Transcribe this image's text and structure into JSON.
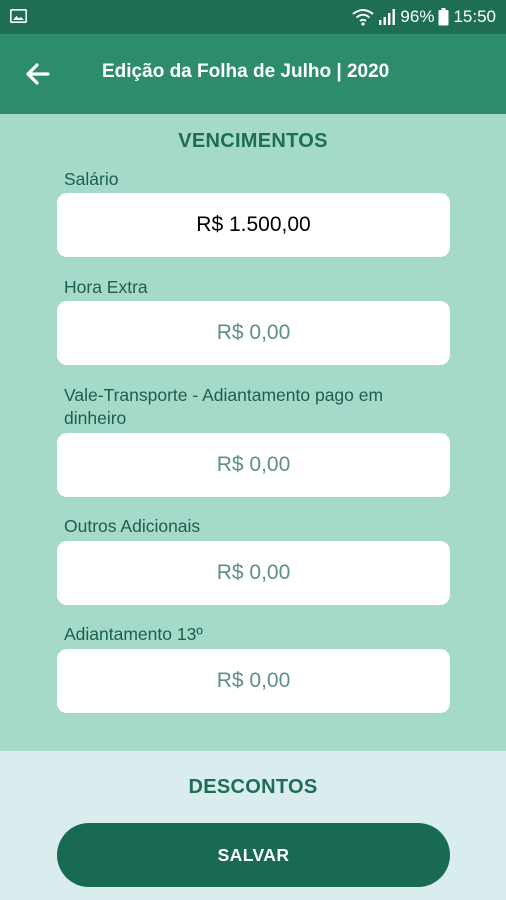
{
  "status_bar": {
    "battery": "96%",
    "time": "15:50",
    "icons": [
      "image-icon",
      "wifi-icon",
      "signal-icon",
      "battery-icon"
    ]
  },
  "app_bar": {
    "title": "Edição da Folha de Julho | 2020",
    "back_icon": "arrow-left-icon"
  },
  "vencimentos": {
    "title": "VENCIMENTOS",
    "fields": [
      {
        "label": "Salário",
        "value": "R$ 1.500,00"
      },
      {
        "label": "Hora Extra",
        "placeholder": "R$ 0,00"
      },
      {
        "label": "Vale-Transporte - Adiantamento pago em dinheiro",
        "placeholder": "R$ 0,00"
      },
      {
        "label": "Outros Adicionais",
        "placeholder": "R$ 0,00"
      },
      {
        "label": "Adiantamento 13º",
        "placeholder": "R$ 0,00"
      }
    ]
  },
  "descontos": {
    "title": "DESCONTOS"
  },
  "save_button": {
    "label": "SALVAR"
  },
  "colors": {
    "status_bar": "#1d6e55",
    "app_bar": "#2d8c6d",
    "content_bg": "#a5d9c9",
    "lower_bg": "#d9ecee",
    "primary_dark": "#186a52"
  }
}
